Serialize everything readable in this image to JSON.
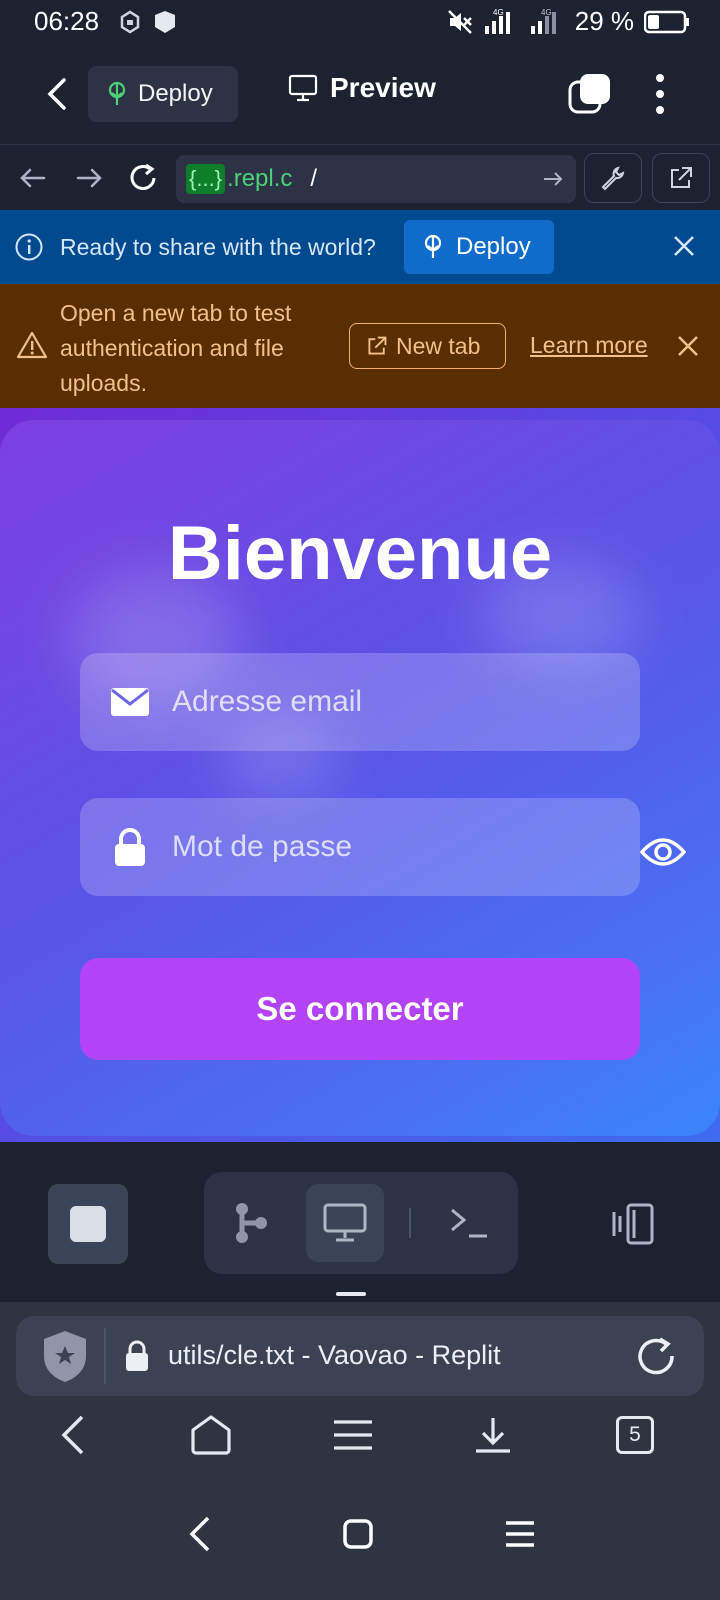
{
  "status": {
    "time": "06:28",
    "battery": "29 %",
    "net1": "4G",
    "net2": "4G"
  },
  "header": {
    "deploy_label": "Deploy",
    "preview_label": "Preview"
  },
  "urlbar": {
    "placeholder_token": "{...}",
    "domain": ".repl.c",
    "path": "/"
  },
  "banner_info": {
    "text": "Ready to share with the world?",
    "button": "Deploy"
  },
  "banner_warn": {
    "text": "Open a new tab to test authentication and file uploads.",
    "newtab": "New tab",
    "learn_more": "Learn more"
  },
  "login": {
    "title": "Bienvenue",
    "email_placeholder": "Adresse email",
    "password_placeholder": "Mot de passe",
    "submit": "Se connecter"
  },
  "browser": {
    "url_text": "utils/cle.txt - Vaovao - Replit",
    "tab_count": "5"
  },
  "colors": {
    "banner_info_bg": "#004a8f",
    "banner_warn_bg": "#5a2f00",
    "submit_bg": "#b344f5",
    "card_start": "#7f3fe0",
    "card_end": "#3a86f8"
  }
}
